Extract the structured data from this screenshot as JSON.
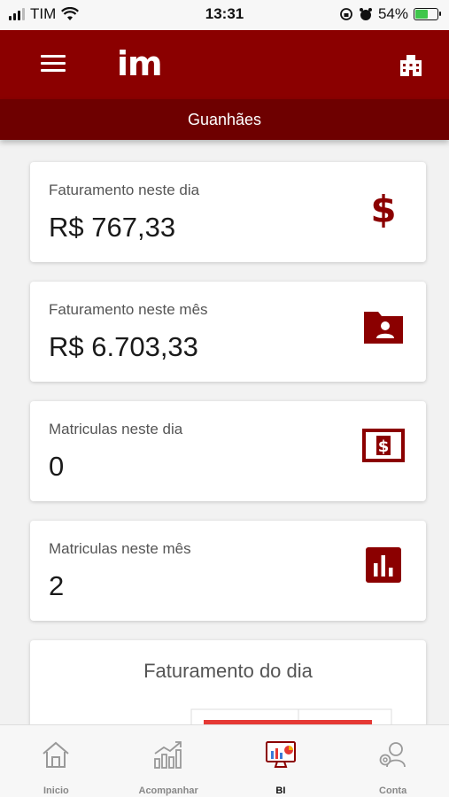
{
  "status_bar": {
    "carrier": "TIM",
    "time": "13:31",
    "battery": "54%"
  },
  "header": {
    "logo": "im",
    "subtitle": "Guanhães"
  },
  "cards": [
    {
      "label": "Faturamento neste dia",
      "value": "R$ 767,33",
      "icon": "dollar-icon"
    },
    {
      "label": "Faturamento neste mês",
      "value": "R$ 6.703,33",
      "icon": "person-folder-icon"
    },
    {
      "label": "Matriculas neste dia",
      "value": "0",
      "icon": "money-bill-icon"
    },
    {
      "label": "Matriculas neste mês",
      "value": "2",
      "icon": "bar-chart-icon"
    }
  ],
  "chart": {
    "title": "Faturamento do dia"
  },
  "nav": [
    {
      "label": "Inicio",
      "icon": "home-icon"
    },
    {
      "label": "Acompanhar",
      "icon": "chart-growth-icon"
    },
    {
      "label": "BI",
      "icon": "dashboard-icon",
      "active": true
    },
    {
      "label": "Conta",
      "icon": "account-icon"
    }
  ],
  "colors": {
    "primary": "#8b0000",
    "primary_dark": "#6e0000",
    "accent": "#e53935"
  }
}
